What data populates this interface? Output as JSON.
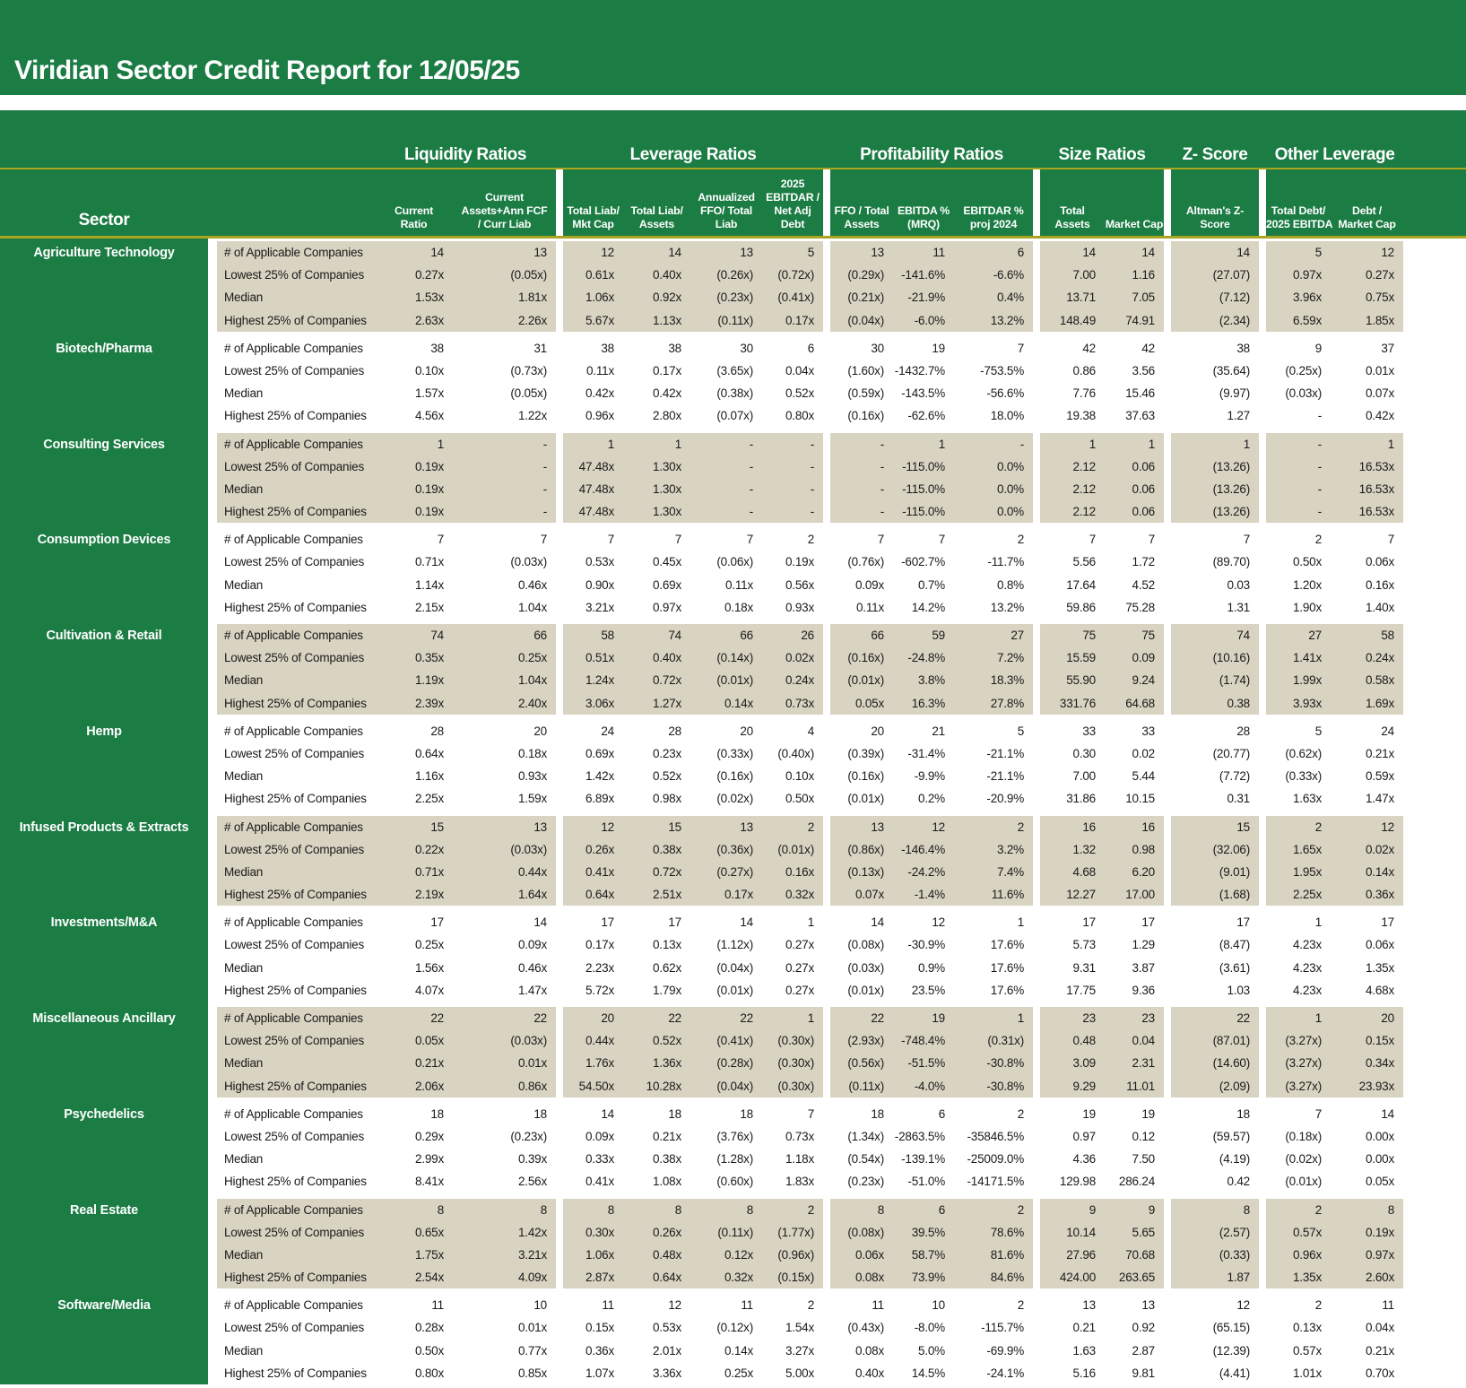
{
  "title": "Viridian Sector Credit Report for 12/05/25",
  "colors": {
    "green": "#1b7c44",
    "beige": "#d9d3c1",
    "accent_line": "#a9a51e"
  },
  "table": {
    "sector_header": "Sector",
    "row_labels": [
      "# of Applicable Companies",
      "Lowest 25% of Companies",
      "Median",
      "Highest 25% of Companies"
    ],
    "groups": [
      {
        "label": "Liquidity Ratios",
        "span": 2
      },
      {
        "label": "Leverage Ratios",
        "span": 4
      },
      {
        "label": "Profitability Ratios",
        "span": 3
      },
      {
        "label": "Size Ratios",
        "span": 2
      },
      {
        "label": "Z- Score",
        "span": 1
      },
      {
        "label": "Other Leverage",
        "span": 2
      }
    ],
    "columns": [
      {
        "lines": [
          "Current",
          "Ratio"
        ]
      },
      {
        "lines": [
          "Current",
          "Assets+Ann FCF",
          "/ Curr Liab"
        ]
      },
      {
        "lines": [
          "Total Liab/",
          "Mkt Cap"
        ]
      },
      {
        "lines": [
          "Total Liab/",
          "Assets"
        ]
      },
      {
        "lines": [
          "Annualized",
          "FFO/ Total",
          "Liab"
        ]
      },
      {
        "lines": [
          "2025",
          "EBITDAR /",
          "Net Adj",
          "Debt"
        ]
      },
      {
        "lines": [
          "FFO / Total",
          "Assets"
        ]
      },
      {
        "lines": [
          "EBITDA %",
          "(MRQ)"
        ]
      },
      {
        "lines": [
          "EBITDAR %",
          "proj 2024"
        ]
      },
      {
        "lines": [
          "Total",
          "Assets"
        ]
      },
      {
        "lines": [
          "Market Cap"
        ]
      },
      {
        "lines": [
          "Altman's Z-",
          "Score"
        ]
      },
      {
        "lines": [
          "Total Debt/",
          "2025 EBITDA"
        ]
      },
      {
        "lines": [
          "Debt /",
          "Market Cap"
        ]
      }
    ],
    "sectors": [
      {
        "name": "Agriculture Technology",
        "rows": [
          [
            "14",
            "13",
            "12",
            "14",
            "13",
            "5",
            "13",
            "11",
            "6",
            "14",
            "14",
            "14",
            "5",
            "12"
          ],
          [
            "0.27x",
            "(0.05x)",
            "0.61x",
            "0.40x",
            "(0.26x)",
            "(0.72x)",
            "(0.29x)",
            "-141.6%",
            "-6.6%",
            "7.00",
            "1.16",
            "(27.07)",
            "0.97x",
            "0.27x"
          ],
          [
            "1.53x",
            "1.81x",
            "1.06x",
            "0.92x",
            "(0.23x)",
            "(0.41x)",
            "(0.21x)",
            "-21.9%",
            "0.4%",
            "13.71",
            "7.05",
            "(7.12)",
            "3.96x",
            "0.75x"
          ],
          [
            "2.63x",
            "2.26x",
            "5.67x",
            "1.13x",
            "(0.11x)",
            "0.17x",
            "(0.04x)",
            "-6.0%",
            "13.2%",
            "148.49",
            "74.91",
            "(2.34)",
            "6.59x",
            "1.85x"
          ]
        ]
      },
      {
        "name": "Biotech/Pharma",
        "rows": [
          [
            "38",
            "31",
            "38",
            "38",
            "30",
            "6",
            "30",
            "19",
            "7",
            "42",
            "42",
            "38",
            "9",
            "37"
          ],
          [
            "0.10x",
            "(0.73x)",
            "0.11x",
            "0.17x",
            "(3.65x)",
            "0.04x",
            "(1.60x)",
            "-1432.7%",
            "-753.5%",
            "0.86",
            "3.56",
            "(35.64)",
            "(0.25x)",
            "0.01x"
          ],
          [
            "1.57x",
            "(0.05x)",
            "0.42x",
            "0.42x",
            "(0.38x)",
            "0.52x",
            "(0.59x)",
            "-143.5%",
            "-56.6%",
            "7.76",
            "15.46",
            "(9.97)",
            "(0.03x)",
            "0.07x"
          ],
          [
            "4.56x",
            "1.22x",
            "0.96x",
            "2.80x",
            "(0.07x)",
            "0.80x",
            "(0.16x)",
            "-62.6%",
            "18.0%",
            "19.38",
            "37.63",
            "1.27",
            "-",
            "0.42x"
          ]
        ]
      },
      {
        "name": "Consulting Services",
        "rows": [
          [
            "1",
            "-",
            "1",
            "1",
            "-",
            "-",
            "-",
            "1",
            "-",
            "1",
            "1",
            "1",
            "-",
            "1"
          ],
          [
            "0.19x",
            "-",
            "47.48x",
            "1.30x",
            "-",
            "-",
            "-",
            "-115.0%",
            "0.0%",
            "2.12",
            "0.06",
            "(13.26)",
            "-",
            "16.53x"
          ],
          [
            "0.19x",
            "-",
            "47.48x",
            "1.30x",
            "-",
            "-",
            "-",
            "-115.0%",
            "0.0%",
            "2.12",
            "0.06",
            "(13.26)",
            "-",
            "16.53x"
          ],
          [
            "0.19x",
            "-",
            "47.48x",
            "1.30x",
            "-",
            "-",
            "-",
            "-115.0%",
            "0.0%",
            "2.12",
            "0.06",
            "(13.26)",
            "-",
            "16.53x"
          ]
        ]
      },
      {
        "name": "Consumption Devices",
        "rows": [
          [
            "7",
            "7",
            "7",
            "7",
            "7",
            "2",
            "7",
            "7",
            "2",
            "7",
            "7",
            "7",
            "2",
            "7"
          ],
          [
            "0.71x",
            "(0.03x)",
            "0.53x",
            "0.45x",
            "(0.06x)",
            "0.19x",
            "(0.76x)",
            "-602.7%",
            "-11.7%",
            "5.56",
            "1.72",
            "(89.70)",
            "0.50x",
            "0.06x"
          ],
          [
            "1.14x",
            "0.46x",
            "0.90x",
            "0.69x",
            "0.11x",
            "0.56x",
            "0.09x",
            "0.7%",
            "0.8%",
            "17.64",
            "4.52",
            "0.03",
            "1.20x",
            "0.16x"
          ],
          [
            "2.15x",
            "1.04x",
            "3.21x",
            "0.97x",
            "0.18x",
            "0.93x",
            "0.11x",
            "14.2%",
            "13.2%",
            "59.86",
            "75.28",
            "1.31",
            "1.90x",
            "1.40x"
          ]
        ]
      },
      {
        "name": "Cultivation & Retail",
        "rows": [
          [
            "74",
            "66",
            "58",
            "74",
            "66",
            "26",
            "66",
            "59",
            "27",
            "75",
            "75",
            "74",
            "27",
            "58"
          ],
          [
            "0.35x",
            "0.25x",
            "0.51x",
            "0.40x",
            "(0.14x)",
            "0.02x",
            "(0.16x)",
            "-24.8%",
            "7.2%",
            "15.59",
            "0.09",
            "(10.16)",
            "1.41x",
            "0.24x"
          ],
          [
            "1.19x",
            "1.04x",
            "1.24x",
            "0.72x",
            "(0.01x)",
            "0.24x",
            "(0.01x)",
            "3.8%",
            "18.3%",
            "55.90",
            "9.24",
            "(1.74)",
            "1.99x",
            "0.58x"
          ],
          [
            "2.39x",
            "2.40x",
            "3.06x",
            "1.27x",
            "0.14x",
            "0.73x",
            "0.05x",
            "16.3%",
            "27.8%",
            "331.76",
            "64.68",
            "0.38",
            "3.93x",
            "1.69x"
          ]
        ]
      },
      {
        "name": "Hemp",
        "rows": [
          [
            "28",
            "20",
            "24",
            "28",
            "20",
            "4",
            "20",
            "21",
            "5",
            "33",
            "33",
            "28",
            "5",
            "24"
          ],
          [
            "0.64x",
            "0.18x",
            "0.69x",
            "0.23x",
            "(0.33x)",
            "(0.40x)",
            "(0.39x)",
            "-31.4%",
            "-21.1%",
            "0.30",
            "0.02",
            "(20.77)",
            "(0.62x)",
            "0.21x"
          ],
          [
            "1.16x",
            "0.93x",
            "1.42x",
            "0.52x",
            "(0.16x)",
            "0.10x",
            "(0.16x)",
            "-9.9%",
            "-21.1%",
            "7.00",
            "5.44",
            "(7.72)",
            "(0.33x)",
            "0.59x"
          ],
          [
            "2.25x",
            "1.59x",
            "6.89x",
            "0.98x",
            "(0.02x)",
            "0.50x",
            "(0.01x)",
            "0.2%",
            "-20.9%",
            "31.86",
            "10.15",
            "0.31",
            "1.63x",
            "1.47x"
          ]
        ]
      },
      {
        "name": "Infused Products & Extracts",
        "rows": [
          [
            "15",
            "13",
            "12",
            "15",
            "13",
            "2",
            "13",
            "12",
            "2",
            "16",
            "16",
            "15",
            "2",
            "12"
          ],
          [
            "0.22x",
            "(0.03x)",
            "0.26x",
            "0.38x",
            "(0.36x)",
            "(0.01x)",
            "(0.86x)",
            "-146.4%",
            "3.2%",
            "1.32",
            "0.98",
            "(32.06)",
            "1.65x",
            "0.02x"
          ],
          [
            "0.71x",
            "0.44x",
            "0.41x",
            "0.72x",
            "(0.27x)",
            "0.16x",
            "(0.13x)",
            "-24.2%",
            "7.4%",
            "4.68",
            "6.20",
            "(9.01)",
            "1.95x",
            "0.14x"
          ],
          [
            "2.19x",
            "1.64x",
            "0.64x",
            "2.51x",
            "0.17x",
            "0.32x",
            "0.07x",
            "-1.4%",
            "11.6%",
            "12.27",
            "17.00",
            "(1.68)",
            "2.25x",
            "0.36x"
          ]
        ]
      },
      {
        "name": "Investments/M&A",
        "rows": [
          [
            "17",
            "14",
            "17",
            "17",
            "14",
            "1",
            "14",
            "12",
            "1",
            "17",
            "17",
            "17",
            "1",
            "17"
          ],
          [
            "0.25x",
            "0.09x",
            "0.17x",
            "0.13x",
            "(1.12x)",
            "0.27x",
            "(0.08x)",
            "-30.9%",
            "17.6%",
            "5.73",
            "1.29",
            "(8.47)",
            "4.23x",
            "0.06x"
          ],
          [
            "1.56x",
            "0.46x",
            "2.23x",
            "0.62x",
            "(0.04x)",
            "0.27x",
            "(0.03x)",
            "0.9%",
            "17.6%",
            "9.31",
            "3.87",
            "(3.61)",
            "4.23x",
            "1.35x"
          ],
          [
            "4.07x",
            "1.47x",
            "5.72x",
            "1.79x",
            "(0.01x)",
            "0.27x",
            "(0.01x)",
            "23.5%",
            "17.6%",
            "17.75",
            "9.36",
            "1.03",
            "4.23x",
            "4.68x"
          ]
        ]
      },
      {
        "name": "Miscellaneous Ancillary",
        "rows": [
          [
            "22",
            "22",
            "20",
            "22",
            "22",
            "1",
            "22",
            "19",
            "1",
            "23",
            "23",
            "22",
            "1",
            "20"
          ],
          [
            "0.05x",
            "(0.03x)",
            "0.44x",
            "0.52x",
            "(0.41x)",
            "(0.30x)",
            "(2.93x)",
            "-748.4%",
            "(0.31x)",
            "0.48",
            "0.04",
            "(87.01)",
            "(3.27x)",
            "0.15x"
          ],
          [
            "0.21x",
            "0.01x",
            "1.76x",
            "1.36x",
            "(0.28x)",
            "(0.30x)",
            "(0.56x)",
            "-51.5%",
            "-30.8%",
            "3.09",
            "2.31",
            "(14.60)",
            "(3.27x)",
            "0.34x"
          ],
          [
            "2.06x",
            "0.86x",
            "54.50x",
            "10.28x",
            "(0.04x)",
            "(0.30x)",
            "(0.11x)",
            "-4.0%",
            "-30.8%",
            "9.29",
            "11.01",
            "(2.09)",
            "(3.27x)",
            "23.93x"
          ]
        ]
      },
      {
        "name": "Psychedelics",
        "rows": [
          [
            "18",
            "18",
            "14",
            "18",
            "18",
            "7",
            "18",
            "6",
            "2",
            "19",
            "19",
            "18",
            "7",
            "14"
          ],
          [
            "0.29x",
            "(0.23x)",
            "0.09x",
            "0.21x",
            "(3.76x)",
            "0.73x",
            "(1.34x)",
            "-2863.5%",
            "-35846.5%",
            "0.97",
            "0.12",
            "(59.57)",
            "(0.18x)",
            "0.00x"
          ],
          [
            "2.99x",
            "0.39x",
            "0.33x",
            "0.38x",
            "(1.28x)",
            "1.18x",
            "(0.54x)",
            "-139.1%",
            "-25009.0%",
            "4.36",
            "7.50",
            "(4.19)",
            "(0.02x)",
            "0.00x"
          ],
          [
            "8.41x",
            "2.56x",
            "0.41x",
            "1.08x",
            "(0.60x)",
            "1.83x",
            "(0.23x)",
            "-51.0%",
            "-14171.5%",
            "129.98",
            "286.24",
            "0.42",
            "(0.01x)",
            "0.05x"
          ]
        ]
      },
      {
        "name": "Real Estate",
        "rows": [
          [
            "8",
            "8",
            "8",
            "8",
            "8",
            "2",
            "8",
            "6",
            "2",
            "9",
            "9",
            "8",
            "2",
            "8"
          ],
          [
            "0.65x",
            "1.42x",
            "0.30x",
            "0.26x",
            "(0.11x)",
            "(1.77x)",
            "(0.08x)",
            "39.5%",
            "78.6%",
            "10.14",
            "5.65",
            "(2.57)",
            "0.57x",
            "0.19x"
          ],
          [
            "1.75x",
            "3.21x",
            "1.06x",
            "0.48x",
            "0.12x",
            "(0.96x)",
            "0.06x",
            "58.7%",
            "81.6%",
            "27.96",
            "70.68",
            "(0.33)",
            "0.96x",
            "0.97x"
          ],
          [
            "2.54x",
            "4.09x",
            "2.87x",
            "0.64x",
            "0.32x",
            "(0.15x)",
            "0.08x",
            "73.9%",
            "84.6%",
            "424.00",
            "263.65",
            "1.87",
            "1.35x",
            "2.60x"
          ]
        ]
      },
      {
        "name": "Software/Media",
        "rows": [
          [
            "11",
            "10",
            "11",
            "12",
            "11",
            "2",
            "11",
            "10",
            "2",
            "13",
            "13",
            "12",
            "2",
            "11"
          ],
          [
            "0.28x",
            "0.01x",
            "0.15x",
            "0.53x",
            "(0.12x)",
            "1.54x",
            "(0.43x)",
            "-8.0%",
            "-115.7%",
            "0.21",
            "0.92",
            "(65.15)",
            "0.13x",
            "0.04x"
          ],
          [
            "0.50x",
            "0.77x",
            "0.36x",
            "2.01x",
            "0.14x",
            "3.27x",
            "0.08x",
            "5.0%",
            "-69.9%",
            "1.63",
            "2.87",
            "(12.39)",
            "0.57x",
            "0.21x"
          ],
          [
            "0.80x",
            "0.85x",
            "1.07x",
            "3.36x",
            "0.25x",
            "5.00x",
            "0.40x",
            "14.5%",
            "-24.1%",
            "5.16",
            "9.81",
            "(4.41)",
            "1.01x",
            "0.70x"
          ]
        ]
      }
    ]
  }
}
